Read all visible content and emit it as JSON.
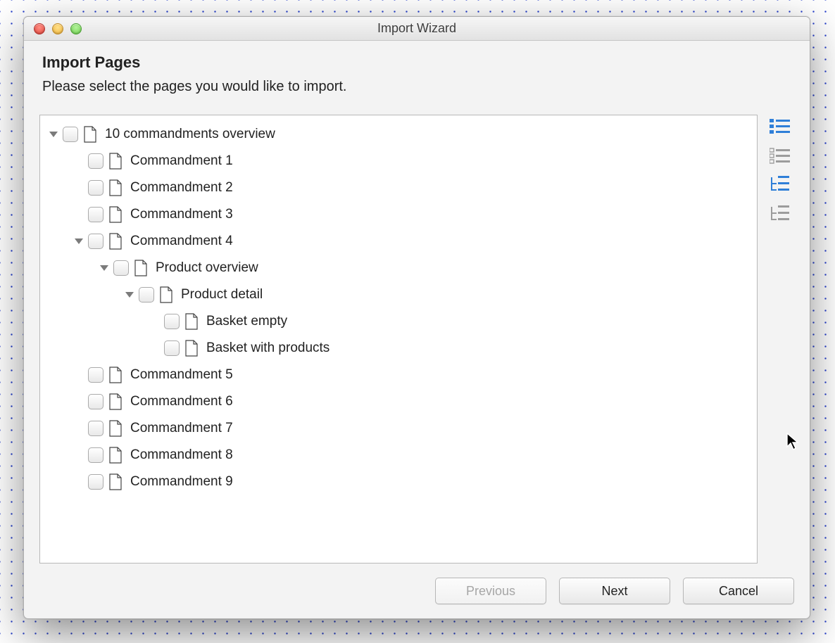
{
  "window": {
    "title": "Import Wizard"
  },
  "header": {
    "title": "Import Pages",
    "subtitle": "Please select the pages you would like to import."
  },
  "tree": {
    "root": {
      "label": "10 commandments overview",
      "expanded": true,
      "children_key": "c"
    },
    "c": {
      "c1": {
        "label": "Commandment 1"
      },
      "c2": {
        "label": "Commandment 2"
      },
      "c3": {
        "label": "Commandment 3"
      },
      "c4": {
        "label": "Commandment 4",
        "expanded": true
      },
      "po": {
        "label": "Product overview",
        "expanded": true
      },
      "pd": {
        "label": "Product detail",
        "expanded": true
      },
      "be": {
        "label": "Basket empty"
      },
      "bw": {
        "label": "Basket with products"
      },
      "c5": {
        "label": "Commandment 5"
      },
      "c6": {
        "label": "Commandment 6"
      },
      "c7": {
        "label": "Commandment 7"
      },
      "c8": {
        "label": "Commandment 8"
      },
      "c9": {
        "label": "Commandment 9"
      }
    }
  },
  "side_tools": {
    "select_all": "select-all",
    "deselect_all": "deselect-all",
    "expand_all": "expand-all",
    "collapse_all": "collapse-all"
  },
  "buttons": {
    "previous": "Previous",
    "next": "Next",
    "cancel": "Cancel"
  }
}
